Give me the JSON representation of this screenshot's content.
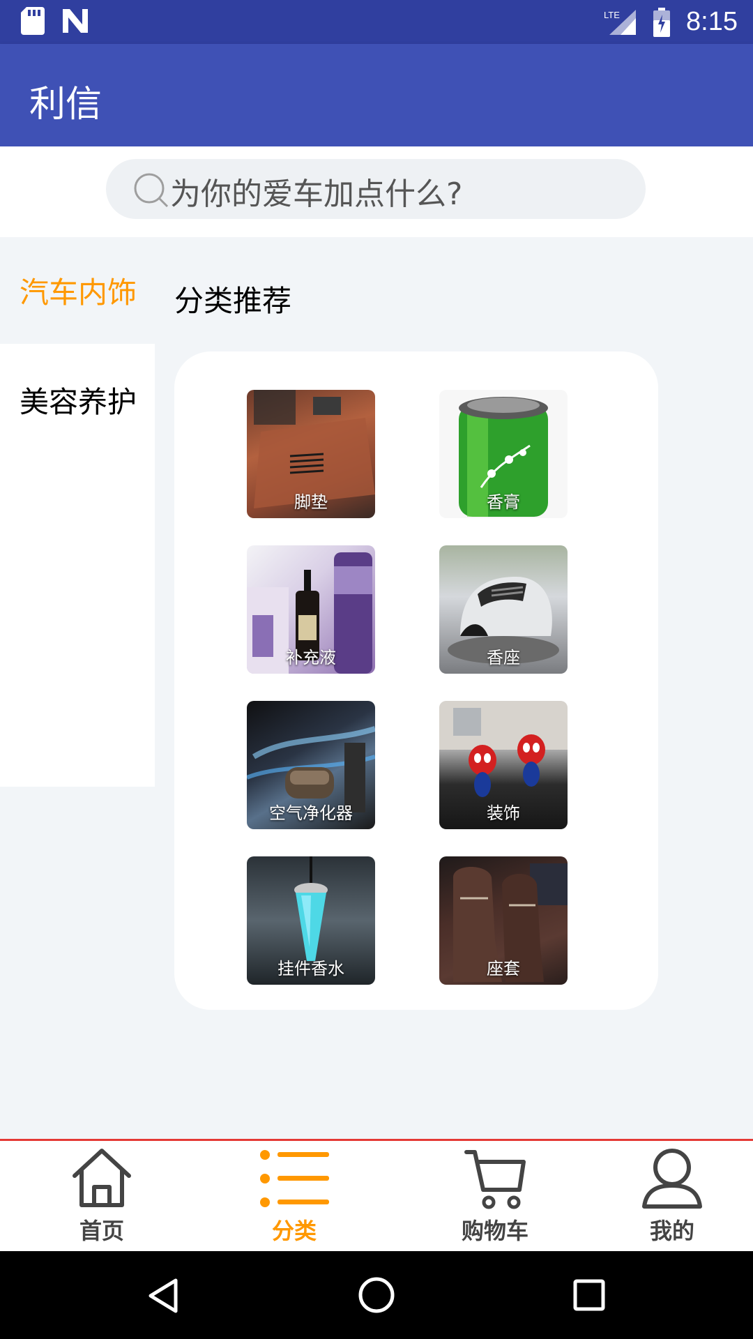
{
  "status_bar": {
    "time": "8:15",
    "network": "LTE",
    "left_icons": [
      "sd-card-icon",
      "n-logo-icon"
    ],
    "right_icons": [
      "signal-icon",
      "battery-icon"
    ]
  },
  "app_bar": {
    "title": "利信"
  },
  "search": {
    "placeholder": "为你的爱车加点什么?"
  },
  "categories": {
    "items": [
      {
        "label": "汽车内饰",
        "active": true
      },
      {
        "label": "美容养护",
        "active": false
      }
    ],
    "section_title": "分类推荐"
  },
  "products": [
    {
      "label": "脚垫"
    },
    {
      "label": "香膏"
    },
    {
      "label": "补充液"
    },
    {
      "label": "香座"
    },
    {
      "label": "空气净化器"
    },
    {
      "label": "装饰"
    },
    {
      "label": "挂件香水"
    },
    {
      "label": "座套"
    }
  ],
  "bottom_nav": {
    "items": [
      {
        "label": "首页",
        "icon": "home-icon"
      },
      {
        "label": "分类",
        "icon": "list-icon",
        "active": true
      },
      {
        "label": "购物车",
        "icon": "cart-icon"
      },
      {
        "label": "我的",
        "icon": "user-icon"
      }
    ]
  },
  "colors": {
    "status_bar": "#303f9f",
    "app_bar": "#3f51b5",
    "accent": "#ff9800",
    "nav_divider": "#e53935"
  }
}
